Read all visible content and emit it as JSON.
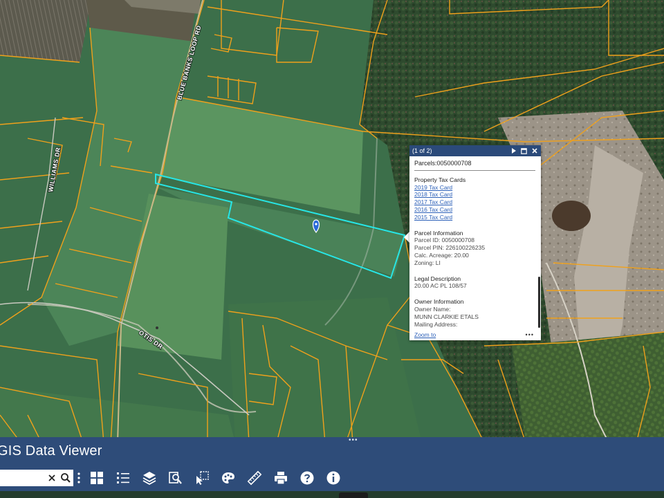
{
  "map": {
    "road_labels": {
      "blue_banks": "BLUE BANKS LOOP RD",
      "williams": "WILLIAMS DR",
      "otis": "OTIS DR"
    },
    "colors": {
      "parcel_line": "#f0a11b",
      "selected_parcel": "#27e6e6",
      "marker": "#2a6ad8"
    }
  },
  "popup": {
    "count": "(1 of 2)",
    "title": "Parcels:0050000708",
    "tax_cards": {
      "heading": "Property Tax Cards",
      "links": [
        "2019 Tax Card",
        "2018 Tax Card",
        "2017 Tax Card",
        "2016 Tax Card",
        "2015 Tax Card"
      ]
    },
    "parcel_info": {
      "heading": "Parcel Information",
      "lines": [
        "Parcel ID: 0050000708",
        "Parcel PIN: 226100226235",
        "Calc. Acreage: 20.00",
        "Zoning: LI"
      ]
    },
    "legal": {
      "heading": "Legal Description",
      "lines": [
        "20.00 AC PL 108/57"
      ]
    },
    "owner": {
      "heading": "Owner Information",
      "lines": [
        "Owner Name:",
        "MUNN CLARKIE ETALS",
        "Mailing Address:"
      ]
    },
    "zoom_to": "Zoom to",
    "more": "•••"
  },
  "toolbar": {
    "app_title": "GIS Data Viewer",
    "search_value": "",
    "tools": [
      "basemap-gallery",
      "legend",
      "layers",
      "query",
      "select",
      "draw",
      "measure",
      "print",
      "help",
      "about"
    ],
    "handle": "•••"
  }
}
